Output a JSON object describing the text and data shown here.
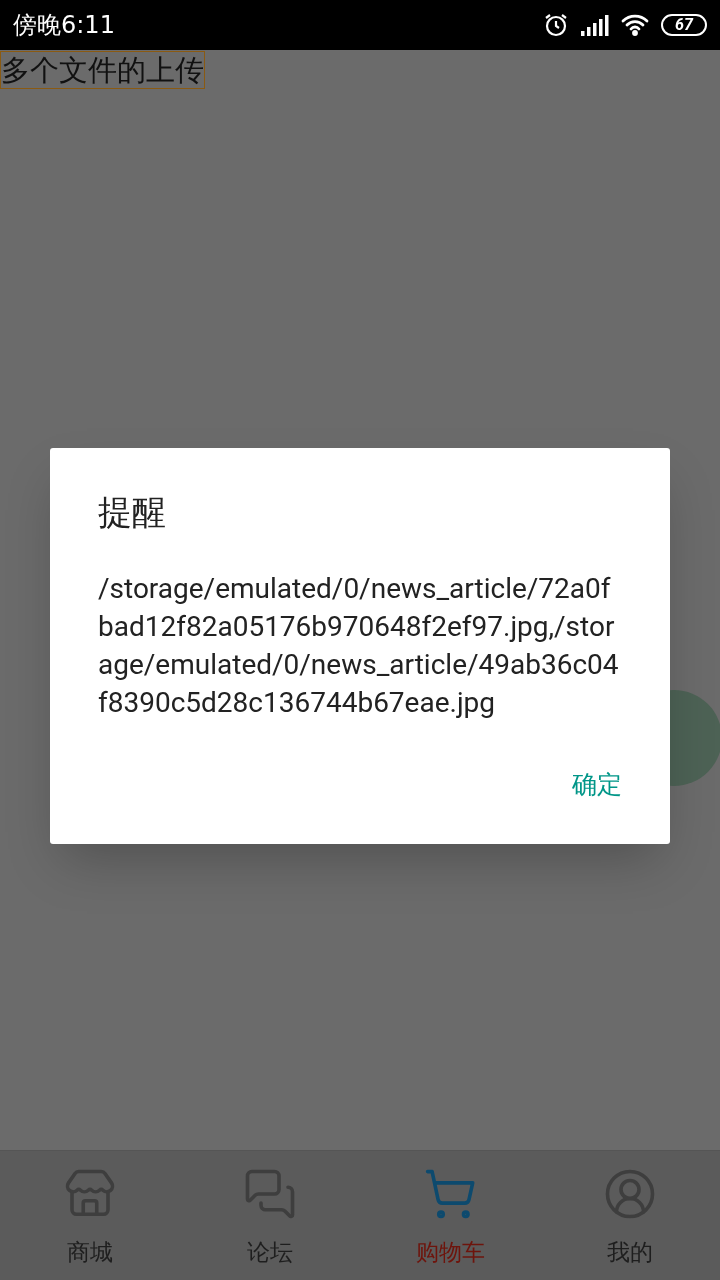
{
  "status_bar": {
    "time": "傍晚6:11",
    "battery": "67"
  },
  "page": {
    "title": "多个文件的上传"
  },
  "dialog": {
    "title": "提醒",
    "message": "/storage/emulated/0/news_article/72a0fbad12f82a05176b970648f2ef97.jpg,/storage/emulated/0/news_article/49ab36c04f8390c5d28c136744b67eae.jpg",
    "buttons": [
      "确定"
    ]
  },
  "bottom_nav": [
    {
      "label": "商城",
      "selected": false
    },
    {
      "label": "论坛",
      "selected": false
    },
    {
      "label": "购物车",
      "selected": true
    },
    {
      "label": "我的",
      "selected": false
    }
  ]
}
